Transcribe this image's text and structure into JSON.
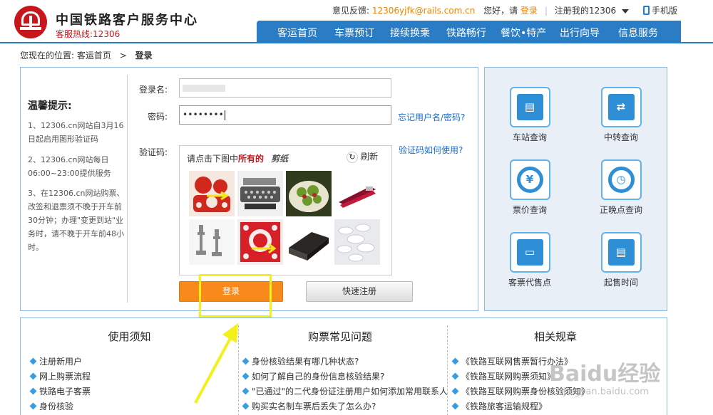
{
  "header": {
    "site_title": "中国铁路客户服务中心",
    "hotline": "客服热线:12306",
    "feedback_label": "意见反馈:",
    "feedback_email": "12306yjfk@rails.com.cn",
    "greeting": "您好，请",
    "login_link": "登录",
    "register_link": "注册",
    "my12306": "我的12306",
    "phone": "手机版"
  },
  "nav": {
    "items": [
      "客运首页",
      "车票预订",
      "接续换乘",
      "铁路畅行",
      "餐饮•特产",
      "出行向导",
      "信息服务"
    ]
  },
  "breadcrumb": {
    "prefix": "您现在的位置:",
    "home": "客运首页",
    "separator": ">",
    "current": "登录"
  },
  "tips": {
    "title": "温馨提示:",
    "items": [
      "1、12306.cn网站自3月16日起启用图形验证码",
      "2、12306.cn网站每日06:00~23:00提供服务",
      "3、在12306.cn网站购票、改签和退票须不晚于开车前30分钟；办理\"变更到站\"业务时，请不晚于开车前48小时。"
    ]
  },
  "form": {
    "username_label": "登录名:",
    "username_value": "",
    "password_label": "密码:",
    "password_value": "••••••••",
    "forgot_link": "忘记用户名/密码?",
    "captcha_label": "验证码:",
    "captcha_help_link": "验证码如何使用?",
    "captcha_prompt_prefix": "请点击下图中",
    "captcha_prompt_emphasis": "所有的",
    "captcha_word": "剪纸",
    "refresh_label": "刷新",
    "login_button": "登录",
    "register_button": "快速注册"
  },
  "services": [
    {
      "label": "车站查询",
      "icon": "station-icon"
    },
    {
      "label": "中转查询",
      "icon": "transfer-icon"
    },
    {
      "label": "票价查询",
      "icon": "price-search-icon"
    },
    {
      "label": "正晚点查询",
      "icon": "stopwatch-icon"
    },
    {
      "label": "客票代售点",
      "icon": "ticket-agency-icon"
    },
    {
      "label": "起售时间",
      "icon": "sale-time-icon"
    }
  ],
  "bottom": {
    "columns": [
      {
        "title": "使用须知",
        "items": [
          "注册新用户",
          "网上购票流程",
          "铁路电子客票",
          "身份核验"
        ]
      },
      {
        "title": "购票常见问题",
        "items": [
          "身份核验结果有哪几种状态?",
          "如何了解自己的身份信息核验结果?",
          "\"已通过\"的二代身份证注册用户如何添加常用联系人",
          "购买实名制车票后丢失了怎么办?"
        ]
      },
      {
        "title": "相关规章",
        "items": [
          "《铁路互联网售票暂行办法》",
          "《铁路互联网购票须知》",
          "《铁路互联网购票身份核验须知》",
          "《铁路旅客运输规程》"
        ]
      }
    ]
  },
  "watermark": {
    "text": "Baidu经验",
    "url": "jingyan.baidu.com"
  },
  "colors": {
    "brand_red": "#c8161d",
    "nav_blue": "#2a7cc4",
    "accent_orange": "#f88a1c",
    "link_blue": "#1a6ccf",
    "highlight_yellow": "#f4f01a"
  }
}
